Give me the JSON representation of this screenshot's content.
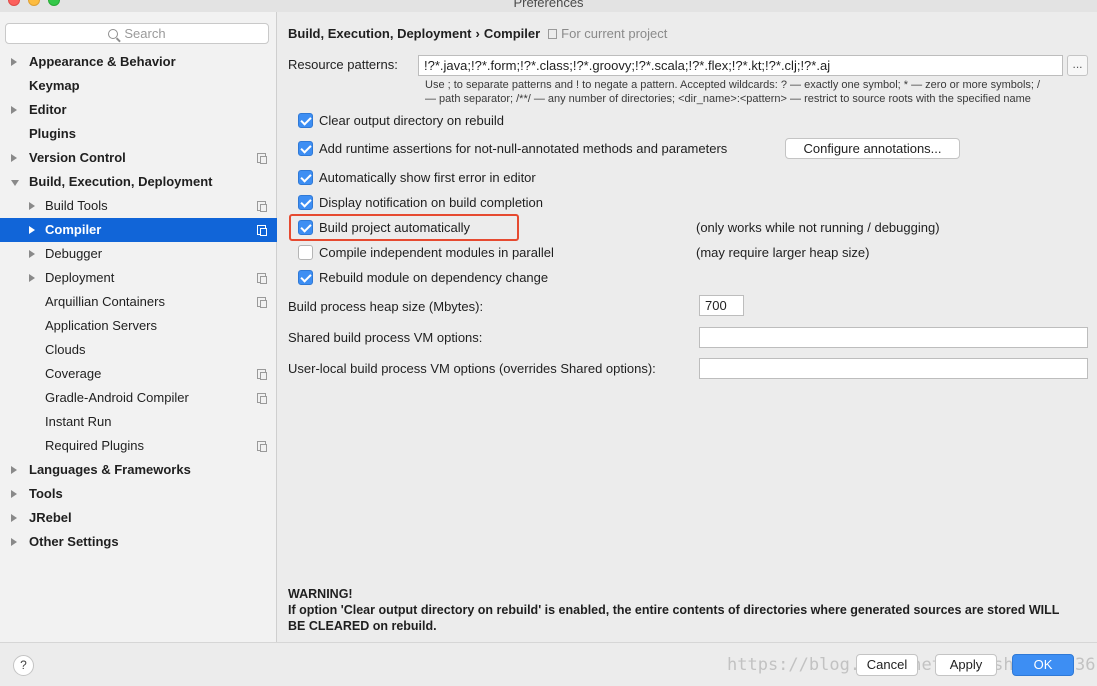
{
  "window": {
    "title": "Preferences"
  },
  "sidebar": {
    "search_placeholder": "Search",
    "items": [
      {
        "label": "Appearance & Behavior"
      },
      {
        "label": "Keymap"
      },
      {
        "label": "Editor"
      },
      {
        "label": "Plugins"
      },
      {
        "label": "Version Control"
      },
      {
        "label": "Build, Execution, Deployment"
      },
      {
        "label": "Build Tools"
      },
      {
        "label": "Compiler"
      },
      {
        "label": "Debugger"
      },
      {
        "label": "Deployment"
      },
      {
        "label": "Arquillian Containers"
      },
      {
        "label": "Application Servers"
      },
      {
        "label": "Clouds"
      },
      {
        "label": "Coverage"
      },
      {
        "label": "Gradle-Android Compiler"
      },
      {
        "label": "Instant Run"
      },
      {
        "label": "Required Plugins"
      },
      {
        "label": "Languages & Frameworks"
      },
      {
        "label": "Tools"
      },
      {
        "label": "JRebel"
      },
      {
        "label": "Other Settings"
      }
    ],
    "selected": "Compiler"
  },
  "breadcrumb": {
    "parent": "Build, Execution, Deployment",
    "separator": "›",
    "current": "Compiler",
    "scope": "For current project"
  },
  "resource_patterns": {
    "label": "Resource patterns:",
    "value": "!?*.java;!?*.form;!?*.class;!?*.groovy;!?*.scala;!?*.flex;!?*.kt;!?*.clj;!?*.aj",
    "button": "...",
    "hint_line1": "Use ; to separate patterns and ! to negate a pattern. Accepted wildcards: ? — exactly one symbol; * — zero or more symbols; /",
    "hint_line2": "— path separator; /**/ — any number of directories; <dir_name>:<pattern> — restrict to source roots with the specified name"
  },
  "options": [
    {
      "label": "Clear output directory on rebuild",
      "checked": true
    },
    {
      "label": "Add runtime assertions for not-null-annotated methods and parameters",
      "checked": true
    },
    {
      "label": "Automatically show first error in editor",
      "checked": true
    },
    {
      "label": "Display notification on build completion",
      "checked": true
    },
    {
      "label": "Build project automatically",
      "checked": true,
      "note": "(only works while not running / debugging)"
    },
    {
      "label": "Compile independent modules in parallel",
      "checked": false,
      "note": "(may require larger heap size)"
    },
    {
      "label": "Rebuild module on dependency change",
      "checked": true
    }
  ],
  "configure_annotations_button": "Configure annotations...",
  "heap_size": {
    "label": "Build process heap size (Mbytes):",
    "value": "700"
  },
  "shared_vm": {
    "label": "Shared build process VM options:",
    "value": ""
  },
  "user_vm": {
    "label": "User-local build process VM options (overrides Shared options):",
    "value": ""
  },
  "warning": {
    "title": "WARNING!",
    "body": "If option 'Clear output directory on rebuild' is enabled, the entire contents of directories where generated sources are stored WILL BE CLEARED on rebuild."
  },
  "footer": {
    "help": "?",
    "cancel": "Cancel",
    "apply": "Apply",
    "ok": "OK",
    "watermark": "https://blog.csdn.net/xiaoshu_38093619"
  },
  "colors": {
    "accent": "#1165d8",
    "checkbox": "#3d8ef3",
    "highlight": "#e64a30"
  }
}
